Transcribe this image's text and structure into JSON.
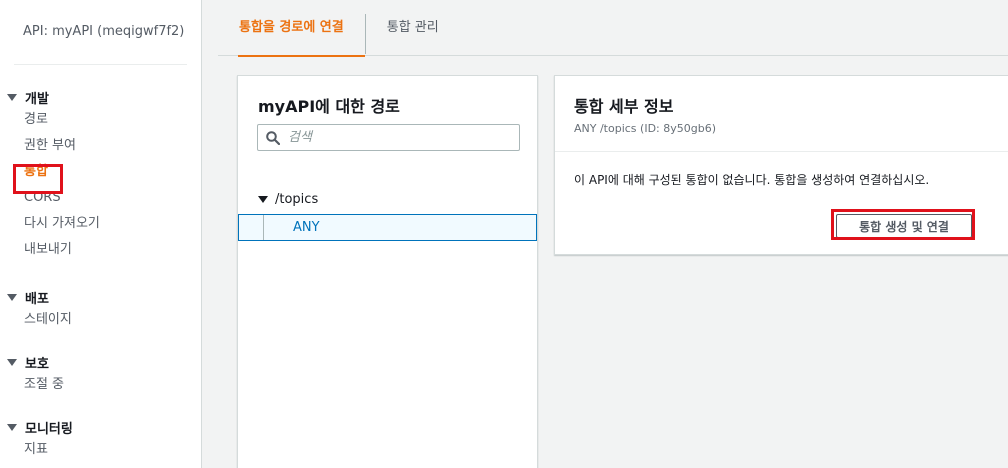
{
  "sidebar": {
    "api_name": "API: myAPI (meqigwf7f2)",
    "sections": [
      {
        "title": "개발",
        "items": [
          "경로",
          "권한 부여",
          "통합",
          "CORS",
          "다시 가져오기",
          "내보내기"
        ]
      },
      {
        "title": "배포",
        "items": [
          "스테이지"
        ]
      },
      {
        "title": "보호",
        "items": [
          "조절 중"
        ]
      },
      {
        "title": "모니터링",
        "items": [
          "지표"
        ]
      }
    ],
    "active_item": "통합"
  },
  "tabs": [
    "통합을 경로에 연결",
    "통합 관리"
  ],
  "active_tab": 0,
  "routes_panel": {
    "title": "myAPI에 대한 경로",
    "search_placeholder": "검색",
    "route_path": "/topics",
    "route_method": "ANY"
  },
  "details_panel": {
    "title": "통합 세부 정보",
    "subtitle": "ANY /topics (ID: 8y50gb6)",
    "message": "이 API에 대해 구성된 통합이 없습니다. 통합을 생성하여 연결하십시오.",
    "button_label": "통합 생성 및 연결"
  },
  "colors": {
    "accent": "#ec7211",
    "link_blue": "#0073bb",
    "highlight_red": "#e0111b"
  }
}
